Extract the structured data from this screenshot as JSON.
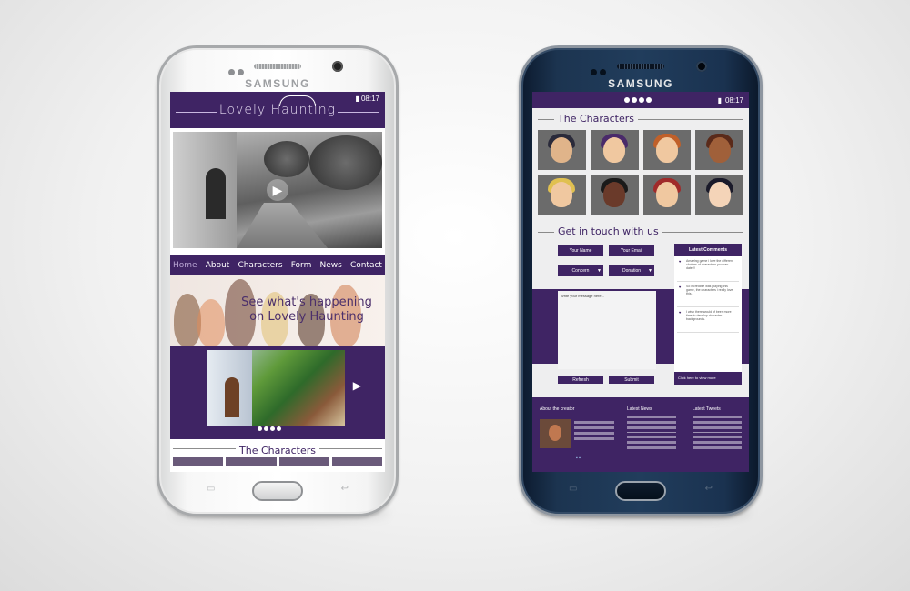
{
  "left_phone": {
    "brand": "SAMSUNG",
    "status_time": "08:17",
    "site_title": "Lovely Haunting",
    "nav": [
      "Home",
      "About",
      "Characters",
      "Form",
      "News",
      "Contact"
    ],
    "banner_line1": "See what's happening",
    "banner_line2": "on Lovely Haunting",
    "characters_heading": "The Characters",
    "icons": {
      "play": "play-icon",
      "next": "arrow-right-icon",
      "back": "back-icon",
      "recent": "recent-apps-icon"
    }
  },
  "right_phone": {
    "brand": "SAMSUNG",
    "status_time": "08:17",
    "characters_heading": "The Characters",
    "contact_heading": "Get in touch with us",
    "form": {
      "name": "Your Name",
      "email": "Your Email",
      "concern": "Concern",
      "donation": "Donation",
      "message_placeholder": "Write your message here...",
      "refresh": "Refresh",
      "submit": "Submit"
    },
    "comments": {
      "title": "Latest Comments",
      "items": [
        "Amazing game i love the different choices of characters you can date!!!",
        "So incredible was playing this game, the characters i really love this.",
        "I wish there would of been more time to develop character backgrounds."
      ],
      "footer": "Click here to view more"
    },
    "footer": {
      "creator": "About the creator",
      "news": "Latest News",
      "tweets": "Latest Tweets"
    }
  }
}
